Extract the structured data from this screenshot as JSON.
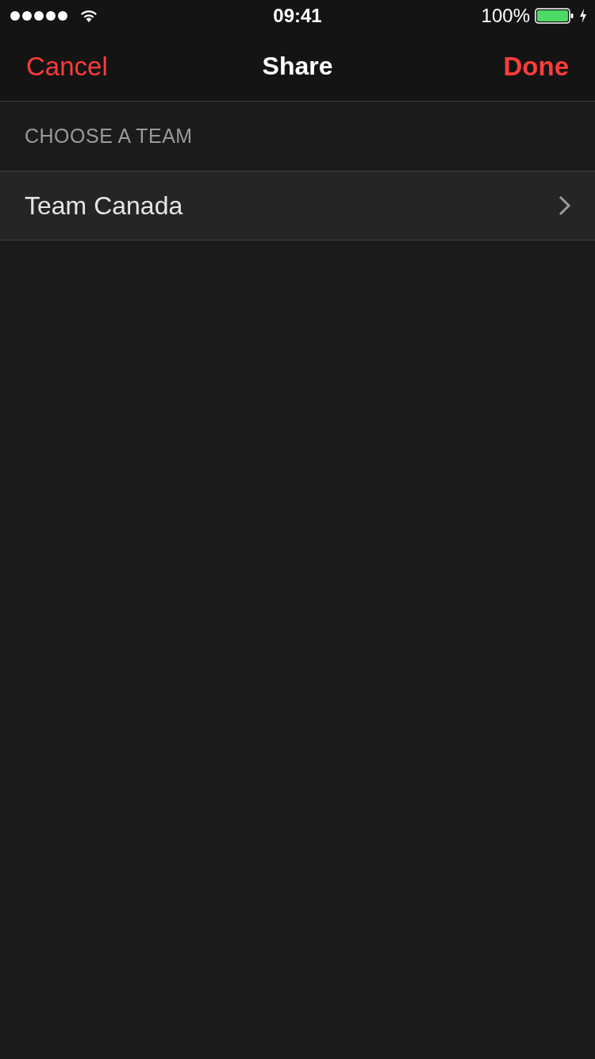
{
  "status_bar": {
    "time": "09:41",
    "battery_percent": "100%"
  },
  "nav_bar": {
    "cancel": "Cancel",
    "title": "Share",
    "done": "Done"
  },
  "section": {
    "header": "CHOOSE A TEAM",
    "items": [
      {
        "label": "Team Canada"
      }
    ]
  }
}
